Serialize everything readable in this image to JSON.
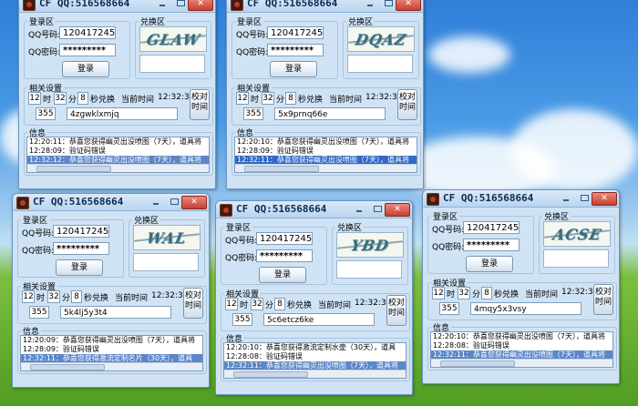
{
  "windows": [
    {
      "title": "CF    QQ:516568664",
      "login_group": "登录区",
      "qq_label": "QQ号码:",
      "qq_value": "120417245",
      "pwd_label": "QQ密码:",
      "pwd_value": "*********",
      "login_btn": "登录",
      "redeem_group": "兑换区",
      "captcha_text": "GLAW",
      "settings_group": "相关设置",
      "hour": "12",
      "hour_unit": "时",
      "minute": "32",
      "minute_unit": "分",
      "seconds": "8",
      "seconds_label": "秒兑换",
      "time_label": "当前时间",
      "current_time": "12:32:32",
      "sync_btn_line1": "校对",
      "sync_btn_line2": "时间",
      "count": "355",
      "code": "4zgwklxmjq",
      "info_group": "信息",
      "log": [
        "12:20:11：恭喜您获得幽灵出没喷图（7天），道具将",
        "12:28:09：验证码错误",
        "12:32:12：恭喜您获得幽灵出没喷图（7天），道具将"
      ]
    },
    {
      "title": "CF    QQ:516568664",
      "login_group": "登录区",
      "qq_label": "QQ号码:",
      "qq_value": "120417245",
      "pwd_label": "QQ密码:",
      "pwd_value": "*********",
      "login_btn": "登录",
      "redeem_group": "兑换区",
      "captcha_text": "DQAZ",
      "settings_group": "相关设置",
      "hour": "12",
      "hour_unit": "时",
      "minute": "32",
      "minute_unit": "分",
      "seconds": "8",
      "seconds_label": "秒兑换",
      "time_label": "当前时间",
      "current_time": "12:32:32",
      "sync_btn_line1": "校对",
      "sync_btn_line2": "时间",
      "count": "355",
      "code": "5x9prnq66e",
      "info_group": "信息",
      "log": [
        "12:20:10：恭喜您获得幽灵出没喷图（7天），道具将",
        "12:28:09：验证码错误",
        "12:32:11：恭喜您获得幽灵出没喷图（7天），道具将"
      ]
    },
    {
      "title": "CF    QQ:516568664",
      "login_group": "登录区",
      "qq_label": "QQ号码:",
      "qq_value": "120417245",
      "pwd_label": "QQ密码:",
      "pwd_value": "*********",
      "login_btn": "登录",
      "redeem_group": "兑换区",
      "captcha_text": "WAL",
      "settings_group": "相关设置",
      "hour": "12",
      "hour_unit": "时",
      "minute": "32",
      "minute_unit": "分",
      "seconds": "8",
      "seconds_label": "秒兑换",
      "time_label": "当前时间",
      "current_time": "12:32:32",
      "sync_btn_line1": "校对",
      "sync_btn_line2": "时间",
      "count": "355",
      "code": "5k4lj5y3t4",
      "info_group": "信息",
      "log": [
        "12:20:09：恭喜您获得幽灵出没喷图（7天），道具将",
        "12:28:09：验证码错误",
        "12:32:11：恭喜您获得激流定制名片（30天），道具"
      ]
    },
    {
      "title": "CF    QQ:516568664",
      "login_group": "登录区",
      "qq_label": "QQ号码:",
      "qq_value": "120417245",
      "pwd_label": "QQ密码:",
      "pwd_value": "*********",
      "login_btn": "登录",
      "redeem_group": "兑换区",
      "captcha_text": "YBD",
      "settings_group": "相关设置",
      "hour": "12",
      "hour_unit": "时",
      "minute": "32",
      "minute_unit": "分",
      "seconds": "8",
      "seconds_label": "秒兑换",
      "time_label": "当前时间",
      "current_time": "12:32:33",
      "sync_btn_line1": "校对",
      "sync_btn_line2": "时间",
      "count": "355",
      "code": "5c6etcz6ke",
      "info_group": "信息",
      "log": [
        "12:20:10：恭喜您获得激流定制水壶（30天），道具",
        "12:28:08：验证码错误",
        "12:32:11：恭喜您获得幽灵出没喷图（7天），道具将"
      ]
    },
    {
      "title": "CF    QQ:516568664",
      "login_group": "登录区",
      "qq_label": "QQ号码:",
      "qq_value": "120417245",
      "pwd_label": "QQ密码:",
      "pwd_value": "*********",
      "login_btn": "登录",
      "redeem_group": "兑换区",
      "captcha_text": "ACSE",
      "settings_group": "相关设置",
      "hour": "12",
      "hour_unit": "时",
      "minute": "32",
      "minute_unit": "分",
      "seconds": "8",
      "seconds_label": "秒兑换",
      "time_label": "当前时间",
      "current_time": "12:32:32",
      "sync_btn_line1": "校对",
      "sync_btn_line2": "时间",
      "count": "355",
      "code": "4mqy5x3vsy",
      "info_group": "信息",
      "log": [
        "12:20:10：恭喜您获得幽灵出没喷图（7天），道具将",
        "12:28:08：验证码错误",
        "12:32:11：恭喜您获得幽灵出没喷图（7天），道具将"
      ]
    }
  ]
}
